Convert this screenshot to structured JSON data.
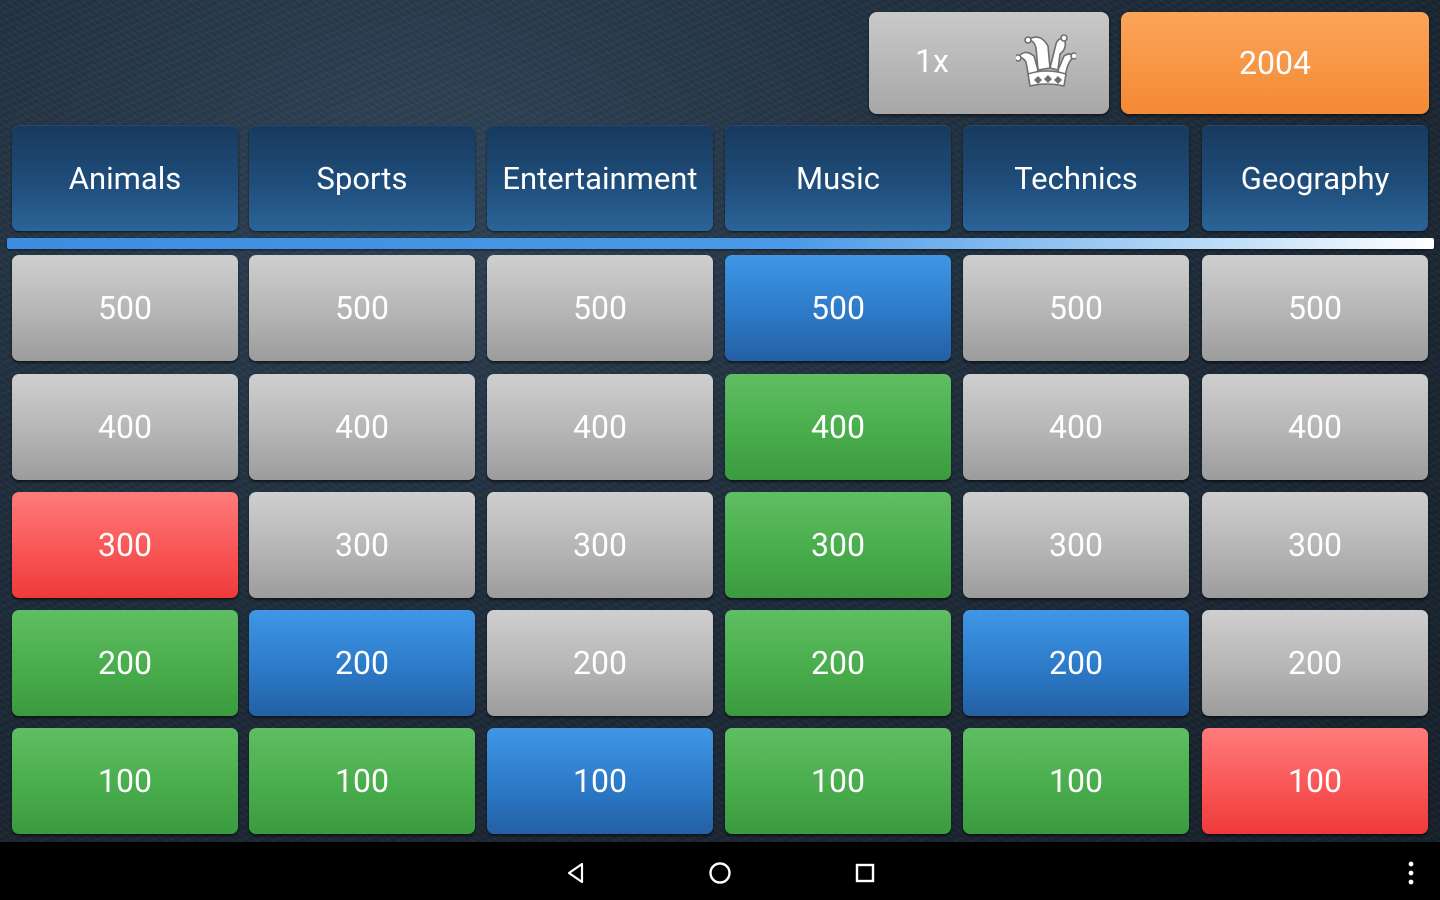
{
  "header": {
    "multiplier_label": "1x",
    "multiplier_icon": "jester-hat-icon",
    "year": "2004"
  },
  "categories": [
    "Animals",
    "Sports",
    "Entertainment",
    "Music",
    "Technics",
    "Geography"
  ],
  "board": {
    "rows": [
      {
        "value": "500",
        "states": [
          "gray",
          "gray",
          "gray",
          "blue",
          "gray",
          "gray"
        ]
      },
      {
        "value": "400",
        "states": [
          "gray",
          "gray",
          "gray",
          "green",
          "gray",
          "gray"
        ]
      },
      {
        "value": "300",
        "states": [
          "red",
          "gray",
          "gray",
          "green",
          "gray",
          "gray"
        ]
      },
      {
        "value": "200",
        "states": [
          "green",
          "blue",
          "gray",
          "green",
          "blue",
          "gray"
        ]
      },
      {
        "value": "100",
        "states": [
          "green",
          "green",
          "blue",
          "green",
          "green",
          "red"
        ]
      }
    ]
  },
  "colors": {
    "gray": "#b5b5b5",
    "blue": "#2c7ac8",
    "green": "#49ad4c",
    "red": "#f95656",
    "orange": "#f48a34",
    "category": "#1f4d7a"
  },
  "navbar": {
    "buttons": [
      "back-icon",
      "home-icon",
      "recents-icon",
      "overflow-menu-icon"
    ]
  }
}
